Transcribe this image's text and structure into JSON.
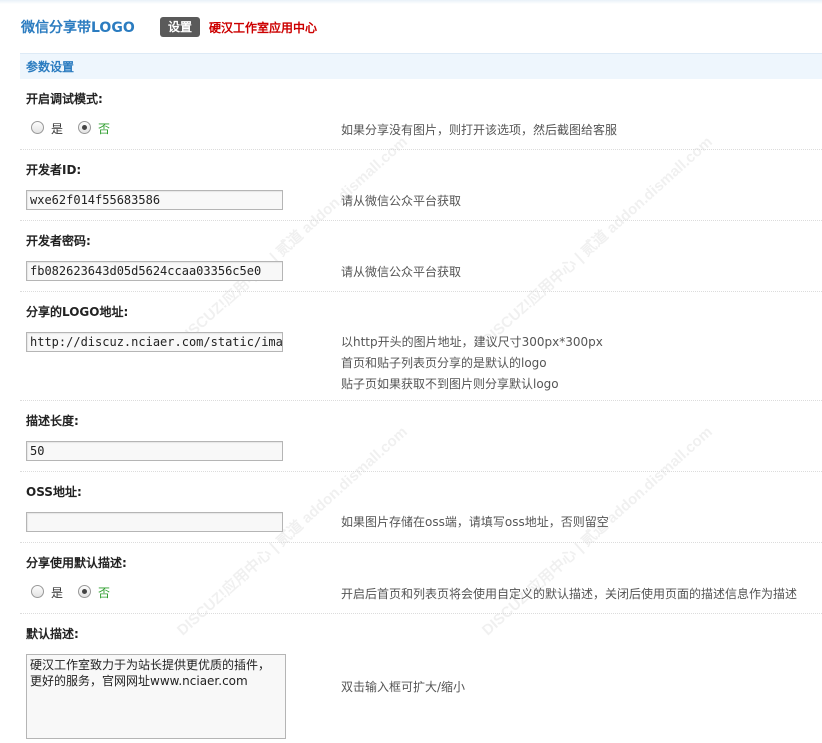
{
  "header": {
    "app_title": "微信分享带LOGO",
    "settings_label": "设置",
    "studio_link": "硬汉工作室应用中心"
  },
  "section": {
    "title": "参数设置"
  },
  "fields": {
    "debug": {
      "label": "开启调试模式:",
      "options": [
        "是",
        "否"
      ],
      "selected": "否",
      "hint": "如果分享没有图片，则打开该选项，然后截图给客服"
    },
    "dev_id": {
      "label": "开发者ID:",
      "value": "wxe62f014f55683586",
      "hint": "请从微信公众平台获取"
    },
    "dev_secret": {
      "label": "开发者密码:",
      "value": "fb082623643d05d5624ccaa03356c5e0",
      "hint": "请从微信公众平台获取"
    },
    "logo_url": {
      "label": "分享的LOGO地址:",
      "value": "http://discuz.nciaer.com/static/image/cor",
      "hint_lines": [
        "以http开头的图片地址，建议尺寸300px*300px",
        "首页和贴子列表页分享的是默认的logo",
        "贴子页如果获取不到图片则分享默认logo"
      ]
    },
    "desc_length": {
      "label": "描述长度:",
      "value": "50"
    },
    "oss": {
      "label": "OSS地址:",
      "value": "",
      "hint": "如果图片存储在oss端，请填写oss地址，否则留空"
    },
    "use_default_desc": {
      "label": "分享使用默认描述:",
      "options": [
        "是",
        "否"
      ],
      "selected": "否",
      "hint": "开启后首页和列表页将会使用自定义的默认描述，关闭后使用页面的描述信息作为描述"
    },
    "default_desc": {
      "label": "默认描述:",
      "value_lines": [
        "硬汉工作室致力于为站长提供更优质的插件，",
        "更好的服务，官网网址www.nciaer.com"
      ],
      "hint": "双击输入框可扩大/缩小"
    }
  },
  "watermark": {
    "text": "DISCUZ!应用中心 | 贰道 addon.dismall.com"
  }
}
